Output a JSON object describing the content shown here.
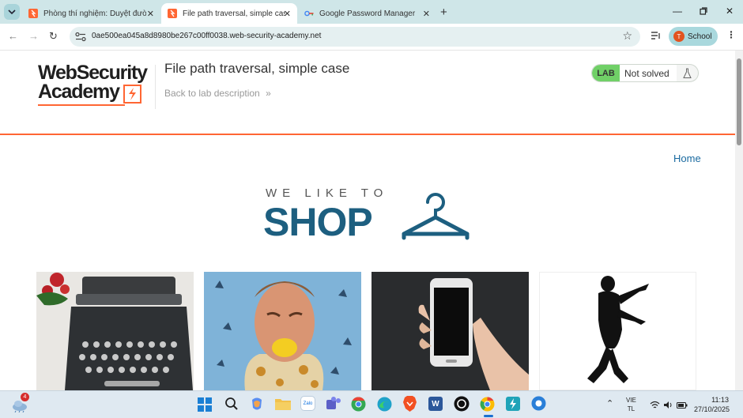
{
  "browser": {
    "tabs": [
      {
        "title": "Phòng thí nghiệm: Duyệt đườn",
        "active": false
      },
      {
        "title": "File path traversal, simple case",
        "active": true
      },
      {
        "title": "Google Password Manager",
        "active": false
      }
    ],
    "url": "0ae500ea045a8d8980be267c00ff0038.web-security-academy.net",
    "profile": {
      "initial": "T",
      "name": "School"
    }
  },
  "header": {
    "logo_line1": "WebSecurity",
    "logo_line2": "Academy",
    "lab_title": "File path traversal, simple case",
    "back_link": "Back to lab description",
    "lab_badge": "LAB",
    "lab_status": "Not solved"
  },
  "nav": {
    "home": "Home"
  },
  "hero": {
    "tagline": "WE LIKE TO",
    "title": "SHOP"
  },
  "products": [
    {
      "image": "typewriter"
    },
    {
      "image": "man-biting-lemon"
    },
    {
      "image": "smartphone-in-hand"
    },
    {
      "image": "zombie-silhouette"
    }
  ],
  "taskbar": {
    "weather_badge": "4",
    "language_line1": "VIE",
    "language_line2": "TL",
    "time": "11:13",
    "date": "27/10/2025"
  },
  "colors": {
    "accent": "#ff6633",
    "shop_blue": "#1d5f80",
    "lab_green": "#70d067",
    "link_blue": "#1a6aa0"
  }
}
